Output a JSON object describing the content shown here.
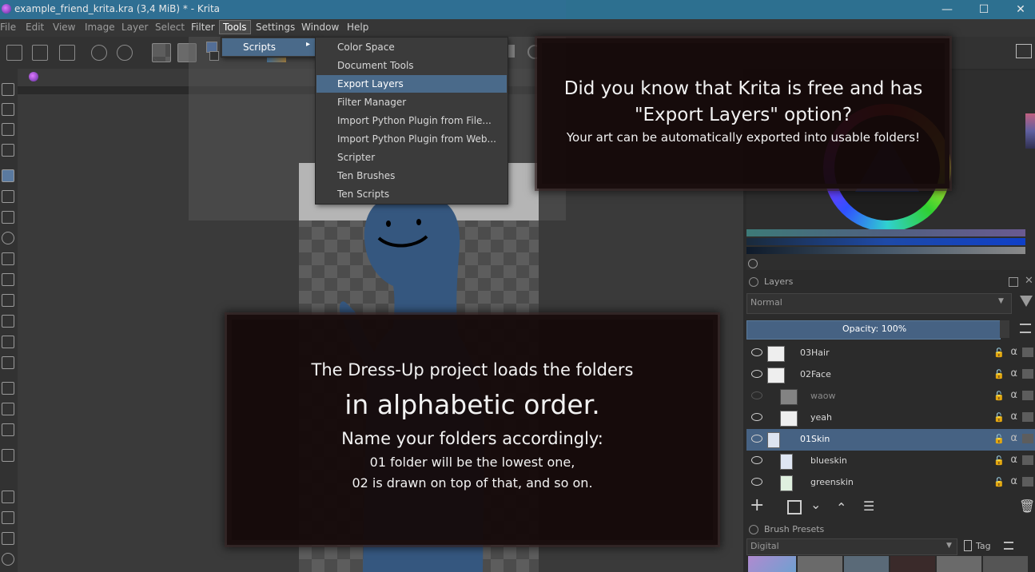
{
  "window": {
    "title": "example_friend_krita.kra (3,4 MiB)  * - Krita",
    "min_glyph": "—",
    "max_glyph": "☐",
    "close_glyph": "✕"
  },
  "menubar": {
    "items": [
      "File",
      "Edit",
      "View",
      "Image",
      "Layer",
      "Select",
      "Filter",
      "Tools",
      "Settings",
      "Window",
      "Help"
    ]
  },
  "tools_menu": {
    "items": [
      {
        "label": "Scripts",
        "arrow": "▸"
      }
    ]
  },
  "scripts_menu": {
    "items": [
      {
        "label": "Color Space"
      },
      {
        "label": "Document Tools"
      },
      {
        "label": "Export Layers"
      },
      {
        "label": "Filter Manager"
      },
      {
        "label": "Import Python Plugin from File..."
      },
      {
        "label": "Import Python Plugin from Web..."
      },
      {
        "label": "Scripter"
      },
      {
        "label": "Ten Brushes"
      },
      {
        "label": "Ten Scripts"
      }
    ],
    "selected_index": 2
  },
  "overlay_top": {
    "line1": "Did you know that Krita is free and has",
    "line2": "\"Export Layers\" option?",
    "line3": "Your art can be automatically exported into usable folders!"
  },
  "overlay_bottom": {
    "line1": "The Dress-Up project loads the folders",
    "line2": "in alphabetic order.",
    "line3": "Name your folders accordingly:",
    "line4": "01 folder will be the lowest one,",
    "line5": "02 is drawn on top of that, and so on."
  },
  "layers_panel": {
    "title": "Layers",
    "blend_mode": "Normal",
    "opacity_label": "Opacity:  100%",
    "layers": [
      {
        "name": "03Hair",
        "visible": true,
        "folder": true,
        "selected": false
      },
      {
        "name": "02Face",
        "visible": true,
        "folder": true,
        "selected": false
      },
      {
        "name": "waow",
        "visible": false,
        "folder": false,
        "selected": false
      },
      {
        "name": "yeah",
        "visible": true,
        "folder": false,
        "selected": false
      },
      {
        "name": "01Skin",
        "visible": true,
        "folder": true,
        "selected": true
      },
      {
        "name": "blueskin",
        "visible": true,
        "folder": false,
        "selected": false
      },
      {
        "name": "greenskin",
        "visible": true,
        "folder": false,
        "selected": false
      }
    ]
  },
  "brush_presets": {
    "title": "Brush Presets",
    "filter_value": "Digital",
    "tag_label": "Tag"
  },
  "colors": {
    "accent": "#466283",
    "menu_selected": "#4a6a8a",
    "title_bar": "#2f6f93",
    "figure": "#35577f"
  }
}
